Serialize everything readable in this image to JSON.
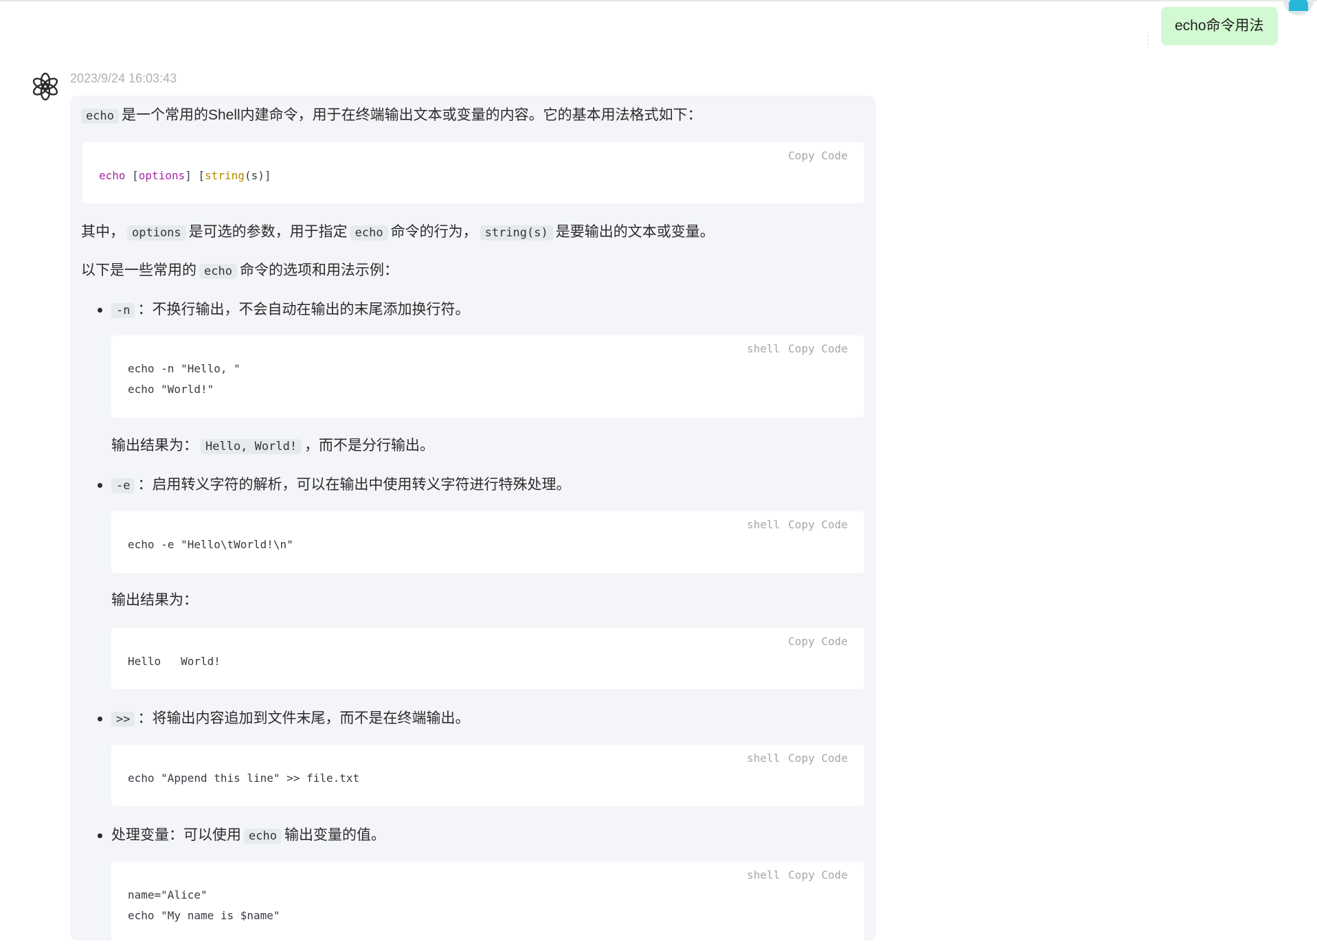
{
  "user": {
    "message": "echo命令用法"
  },
  "bot": {
    "timestamp": "2023/9/24 16:03:43",
    "intro": {
      "code": "echo",
      "text": "是一个常用的Shell内建命令，用于在终端输出文本或变量的内容。它的基本用法格式如下："
    },
    "code_syntax": {
      "tools": [
        "Copy",
        "Code"
      ],
      "parts": [
        "echo",
        " [",
        "options",
        "] [",
        "string",
        "(s)]"
      ]
    },
    "p_options": {
      "t1": "其中，",
      "c1": "options",
      "t2": "是可选的参数，用于指定",
      "c2": "echo",
      "t3": "命令的行为，",
      "c3": "string(s)",
      "t4": "是要输出的文本或变量。"
    },
    "p_examples": {
      "t1": "以下是一些常用的",
      "c1": "echo",
      "t2": "命令的选项和用法示例："
    },
    "item_n": {
      "code": "-n",
      "text": "：不换行输出，不会自动在输出的末尾添加换行符。"
    },
    "code_n": {
      "lang": "shell",
      "tools": [
        "Copy",
        "Code"
      ],
      "lines": [
        "echo -n \"Hello, \"",
        "echo \"World!\""
      ]
    },
    "result_n": {
      "t1": "输出结果为：",
      "c1": "Hello, World!",
      "t2": "，而不是分行输出。"
    },
    "item_e": {
      "code": "-e",
      "text": "：启用转义字符的解析，可以在输出中使用转义字符进行特殊处理。"
    },
    "code_e": {
      "lang": "shell",
      "tools": [
        "Copy",
        "Code"
      ],
      "lines": [
        "echo -e \"Hello\\tWorld!\\n\""
      ]
    },
    "result_e": {
      "text": "输出结果为："
    },
    "code_out": {
      "tools": [
        "Copy",
        "Code"
      ],
      "lines": [
        "Hello   World!"
      ]
    },
    "item_append": {
      "code": ">>",
      "text": "：将输出内容追加到文件末尾，而不是在终端输出。"
    },
    "code_append": {
      "lang": "shell",
      "tools": [
        "Copy",
        "Code"
      ],
      "lines": [
        "echo \"Append this line\" >> file.txt"
      ]
    },
    "item_var": {
      "t1": "处理变量：可以使用",
      "c1": "echo",
      "t2": "输出变量的值。"
    },
    "code_var": {
      "lang": "shell",
      "tools": [
        "Copy",
        "Code"
      ],
      "lines": [
        "name=\"Alice\"",
        "echo \"My name is $name\""
      ]
    }
  }
}
